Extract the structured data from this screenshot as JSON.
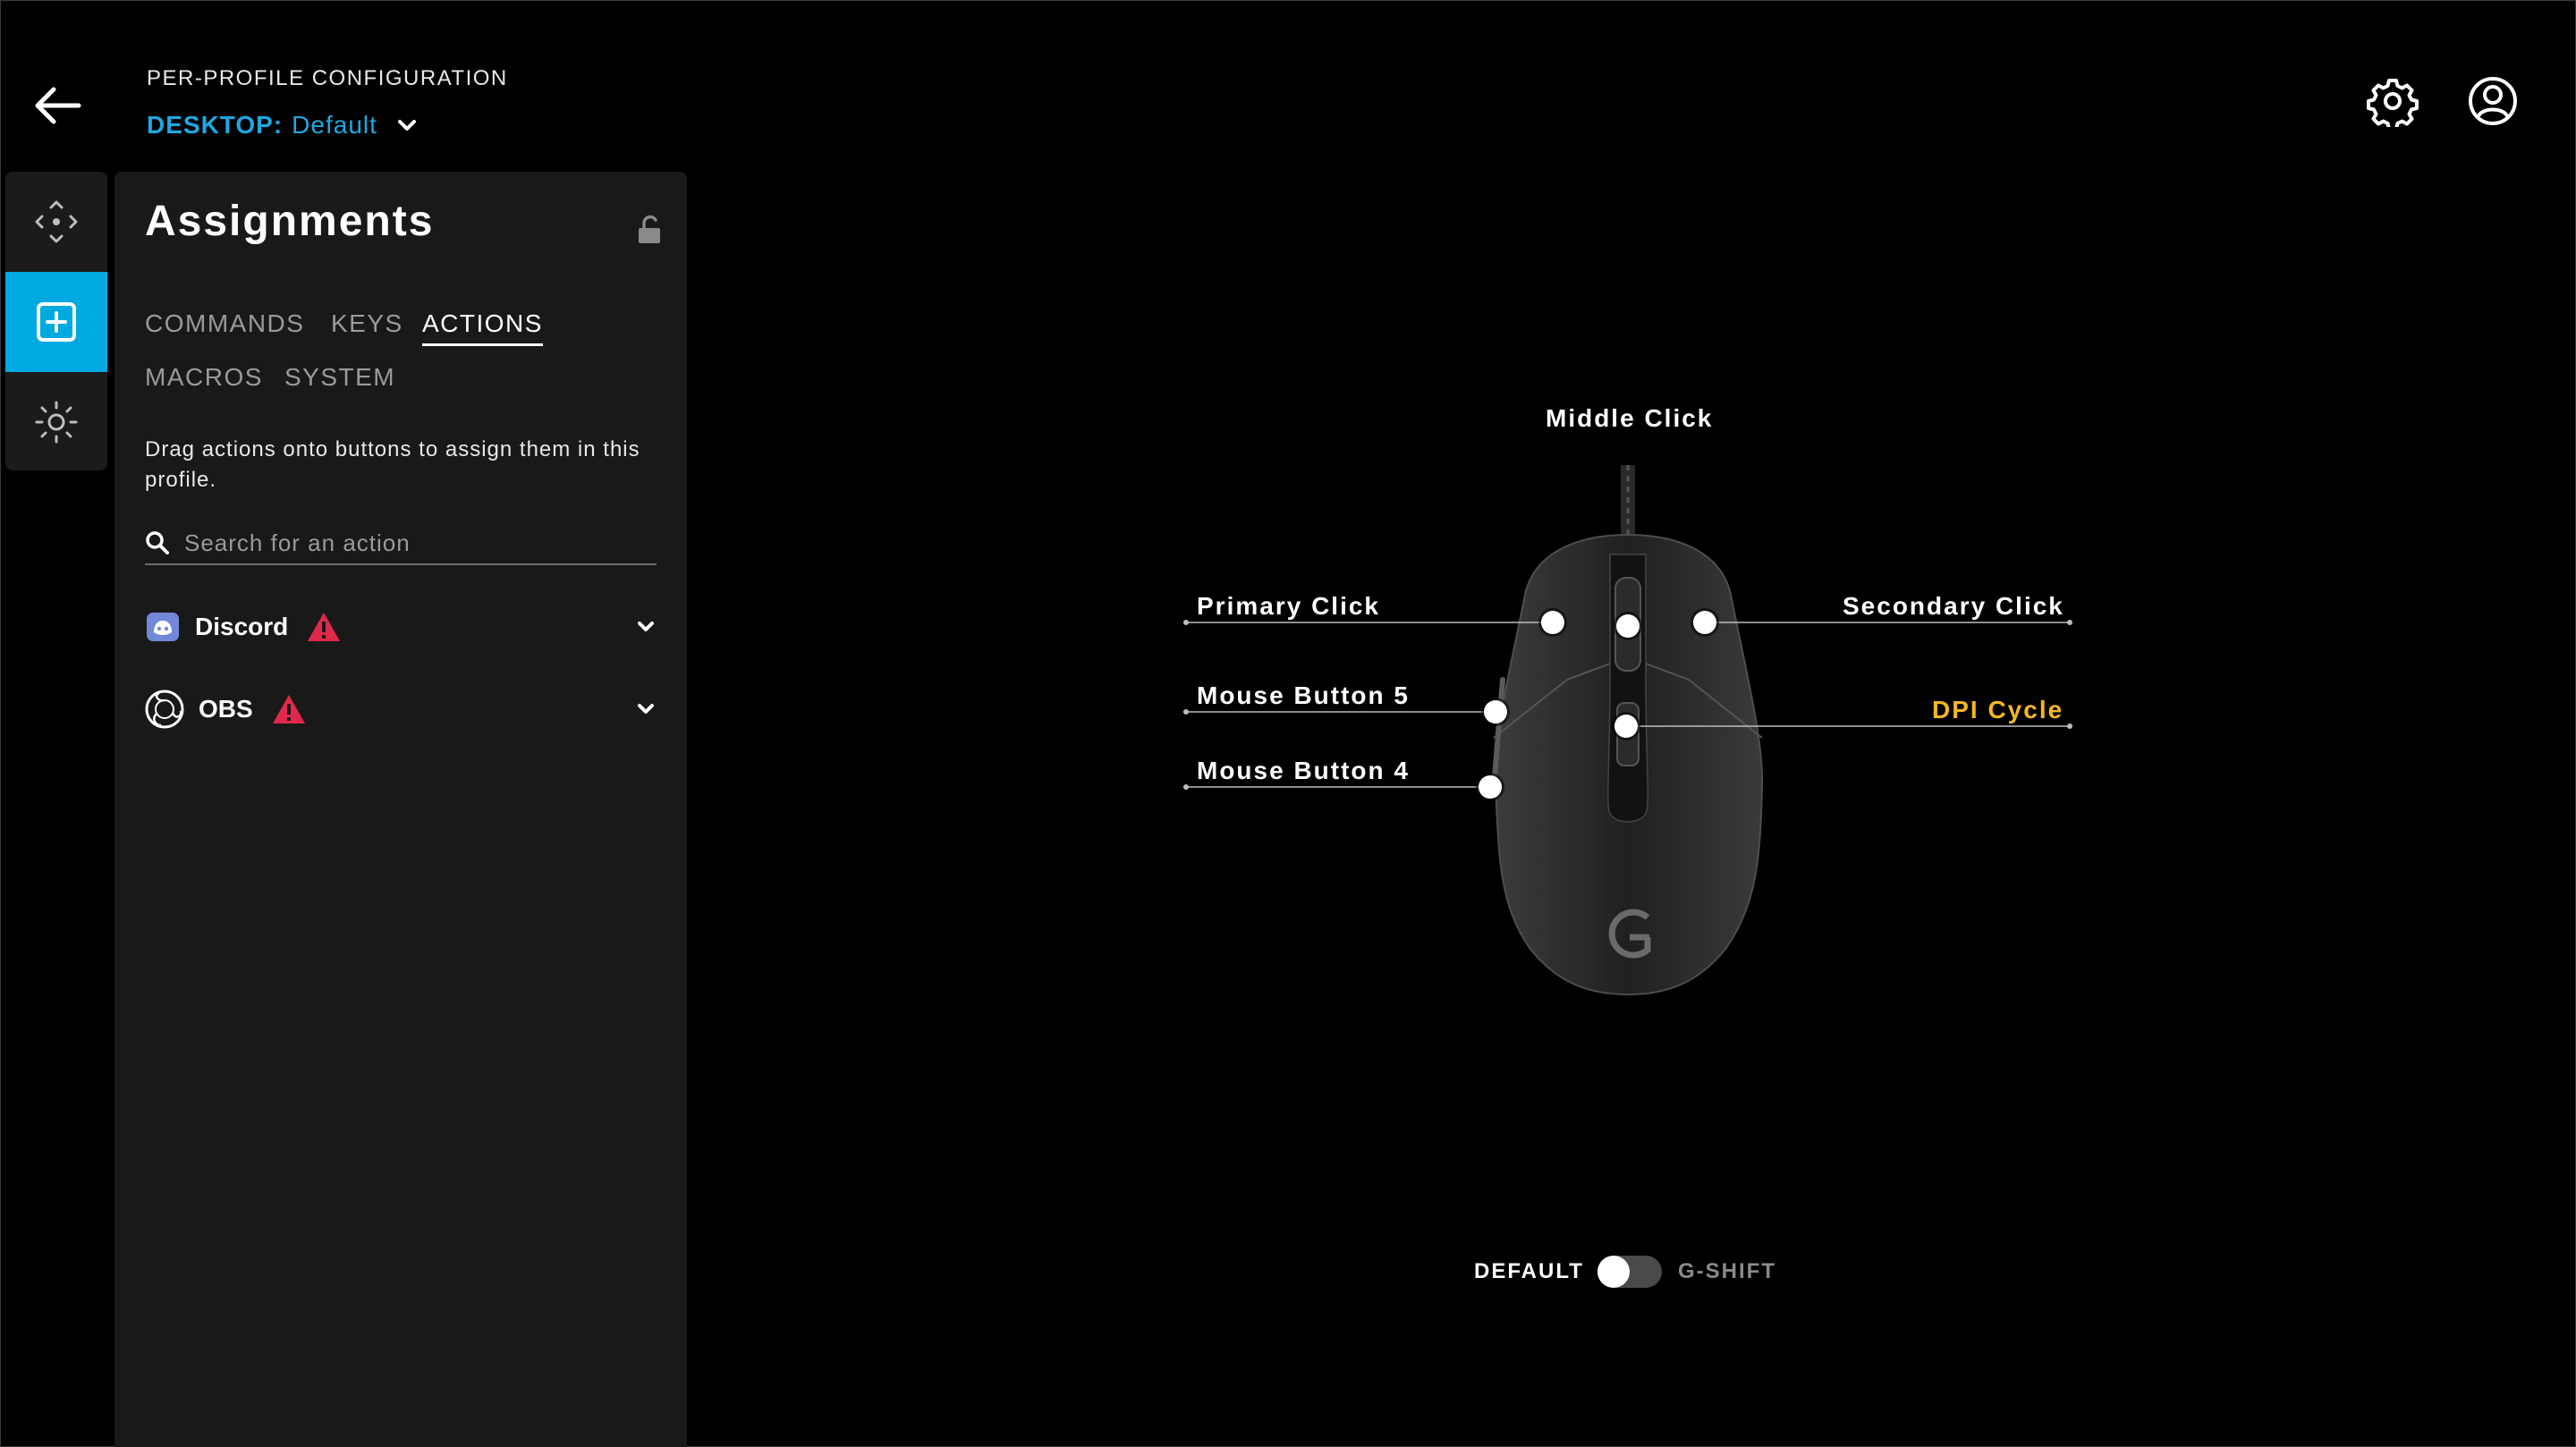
{
  "header": {
    "section_title": "PER-PROFILE CONFIGURATION",
    "profile_prefix": "DESKTOP:",
    "profile_name": "Default"
  },
  "panel": {
    "title": "Assignments",
    "tabs": [
      {
        "label": "COMMANDS",
        "active": false
      },
      {
        "label": "KEYS",
        "active": false
      },
      {
        "label": "ACTIONS",
        "active": true
      },
      {
        "label": "MACROS",
        "active": false
      },
      {
        "label": "SYSTEM",
        "active": false
      }
    ],
    "hint": "Drag actions onto buttons to assign them in this profile.",
    "search_placeholder": "Search for an action",
    "integrations": [
      {
        "name": "Discord",
        "icon": "discord-icon",
        "warning": true
      },
      {
        "name": "OBS",
        "icon": "obs-icon",
        "warning": true
      }
    ]
  },
  "mouse": {
    "callouts": {
      "middle": "Middle Click",
      "primary": "Primary Click",
      "secondary": "Secondary Click",
      "button5": "Mouse Button 5",
      "button4": "Mouse Button 4",
      "dpi": "DPI Cycle"
    },
    "highlight_color": "#f3b722"
  },
  "mode_toggle": {
    "left_label": "DEFAULT",
    "right_label": "G-SHIFT",
    "state": "DEFAULT"
  },
  "colors": {
    "accent": "#00a9e0",
    "warning": "#e0294a",
    "panel_bg": "#191919"
  }
}
